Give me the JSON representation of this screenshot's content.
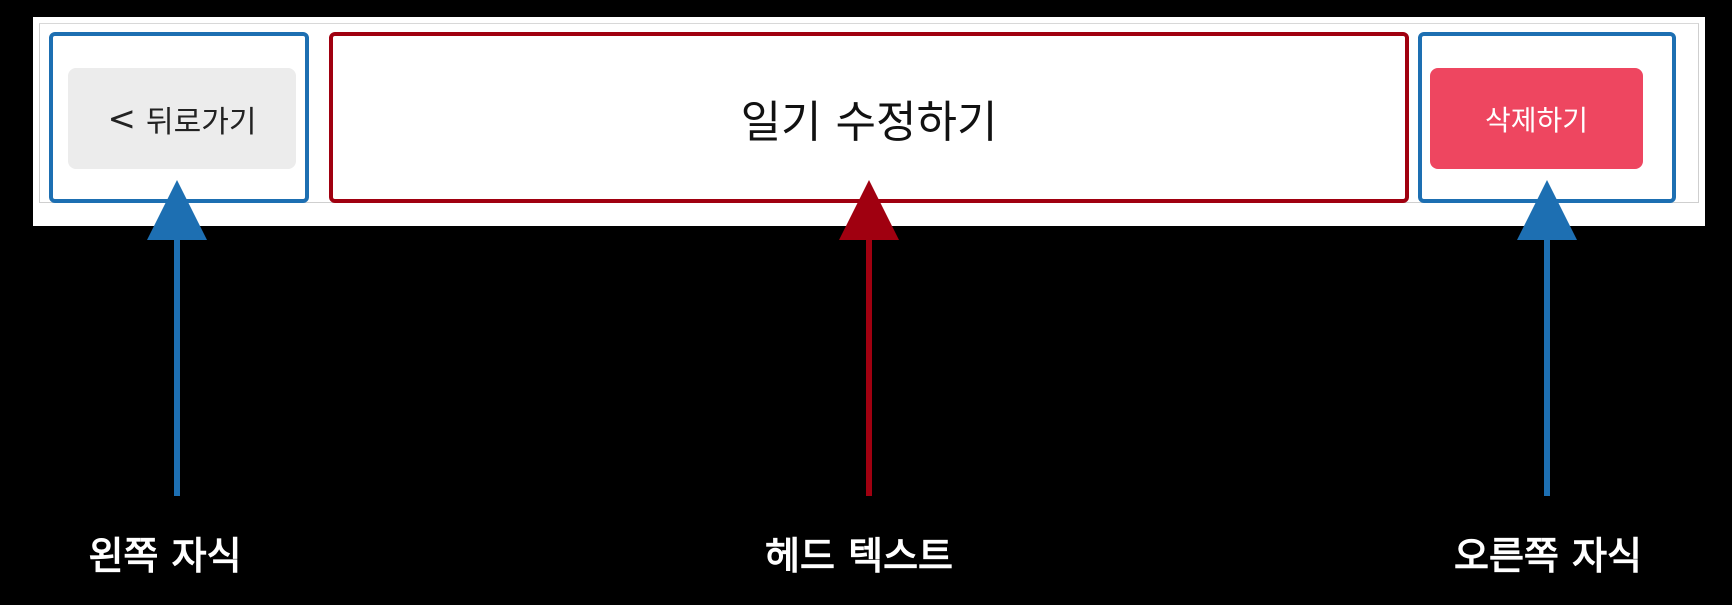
{
  "header": {
    "back_button": {
      "chevron": "<",
      "label": "뒤로가기"
    },
    "title": "일기 수정하기",
    "delete_button": {
      "label": "삭제하기"
    }
  },
  "annotations": {
    "left": {
      "caption": "왼쪽 자식",
      "color": "#1d6fb2"
    },
    "center": {
      "caption": "헤드 텍스트",
      "color": "#a00010"
    },
    "right": {
      "caption": "오른쪽 자식",
      "color": "#1d6fb2"
    }
  },
  "colors": {
    "background": "#000000",
    "delete_button": "#ee4660",
    "back_button": "#ececec"
  }
}
